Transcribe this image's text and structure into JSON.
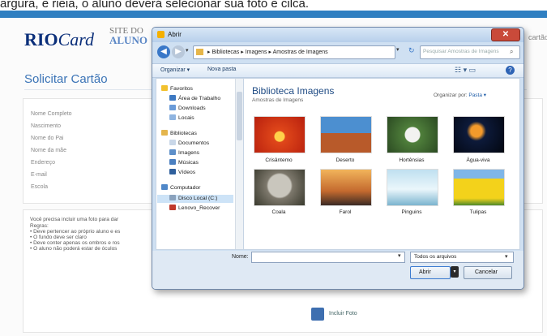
{
  "caption": "argura, e rieia, o aluno deverá selecionar sua foto e cilca.",
  "site": {
    "logo_bold": "RIO",
    "logo_script": "Card",
    "site_label_top": "SITE DO",
    "site_label_main": "ALUNO",
    "right_cut_text": "cartão",
    "page_title": "Solicitar Cartão"
  },
  "form": {
    "labels": [
      "Nome Completo",
      "Nascimento",
      "Nome do Pai",
      "Nome da mãe",
      "Endereço",
      "E-mail",
      "Escola"
    ]
  },
  "info": {
    "lines": [
      "Você precisa incluir uma foto para dar",
      "Regras:",
      "• Deve pertencer ao próprio aluno e es",
      "• O fundo deve ser claro",
      "• Deve conter apenas os ombros e ros",
      "• O aluno não poderá estar de óculos"
    ],
    "upload_label": "Incluir Foto"
  },
  "dialog": {
    "title": "Abrir",
    "address": "▸ Bibliotecas ▸ Imagens ▸ Amostras de Imagens",
    "search_placeholder": "Pesquisar Amostras de Imagens",
    "toolbar": {
      "organize": "Organizar ▾",
      "new_folder": "Nova pasta"
    },
    "nav": {
      "favorites": "Favoritos",
      "desktop": "Área de Trabalho",
      "downloads": "Downloads",
      "locais": "Locais",
      "libraries": "Bibliotecas",
      "documents": "Documentos",
      "images": "Imagens",
      "music": "Músicas",
      "videos": "Vídeos",
      "computer": "Computador",
      "local_disk": "Disco Local (C:)",
      "recovery": "Lenovo_Recover"
    },
    "library_title": "Biblioteca Imagens",
    "library_subtitle": "Amostras de Imagens",
    "arrange_label": "Organizar por:",
    "arrange_value": "Pasta ▾",
    "images": [
      "Crisântemo",
      "Deserto",
      "Hortênsias",
      "Água-viva",
      "Coala",
      "Farol",
      "Pinguins",
      "Tulipas"
    ],
    "name_label": "Nome:",
    "filter_value": "Todos os arquivos",
    "open_label": "Abrir",
    "cancel_label": "Cancelar"
  },
  "colors": {
    "brand_blue": "#2f7fc1",
    "title_blue": "#3a73b6",
    "close_red": "#c94a3a",
    "selection": "#cde3f7"
  }
}
